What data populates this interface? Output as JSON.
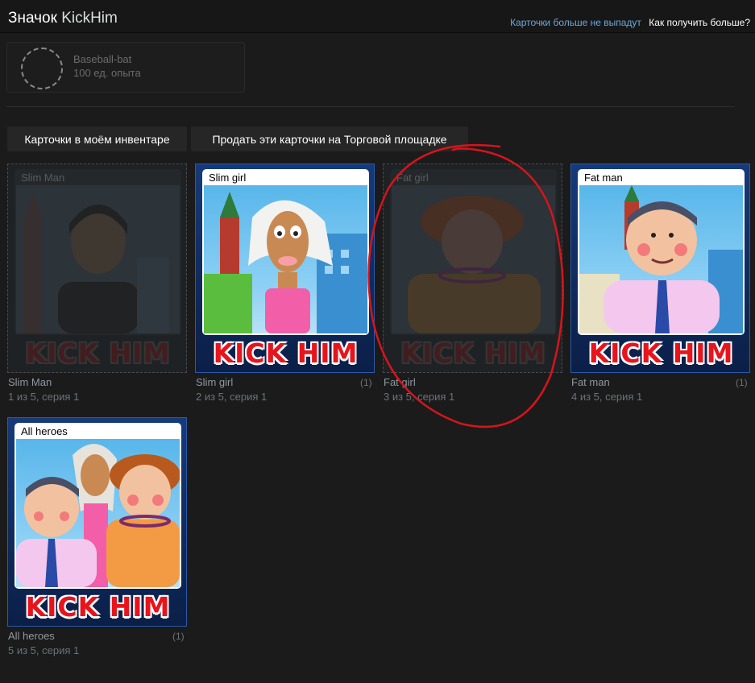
{
  "header": {
    "title_prefix": "Значок",
    "title_game": "KickHim",
    "link_no_drop": "Карточки больше не выпадут",
    "link_how_more": "Как получить больше?"
  },
  "badge": {
    "name": "Baseball-bat",
    "xp": "100 ед. опыта"
  },
  "buttons": {
    "inventory": "Карточки в моём инвентаре",
    "market": "Продать эти карточки на Торговой площадке"
  },
  "cards": [
    {
      "art_label": "Slim Man",
      "name": "Slim Man",
      "meta": "1 из 5, серия 1",
      "count": "",
      "owned": false,
      "logo": "KICK HIM"
    },
    {
      "art_label": "Slim girl",
      "name": "Slim girl",
      "meta": "2 из 5, серия 1",
      "count": "(1)",
      "owned": true,
      "logo": "KICK HIM"
    },
    {
      "art_label": "Fat girl",
      "name": "Fat girl",
      "meta": "3 из 5, серия 1",
      "count": "",
      "owned": false,
      "logo": "KICK HIM"
    },
    {
      "art_label": "Fat man",
      "name": "Fat man",
      "meta": "4 из 5, серия 1",
      "count": "(1)",
      "owned": true,
      "logo": "KICK HIM"
    },
    {
      "art_label": "All heroes",
      "name": "All heroes",
      "meta": "5 из 5, серия 1",
      "count": "(1)",
      "owned": true,
      "logo": "KICK HIM"
    }
  ],
  "colors": {
    "background": "#1b1b1b",
    "link_blue": "#6fa7d9",
    "card_blue": "#163a7a",
    "logo_red": "#e8141c",
    "annotation_red": "#d6141c"
  }
}
